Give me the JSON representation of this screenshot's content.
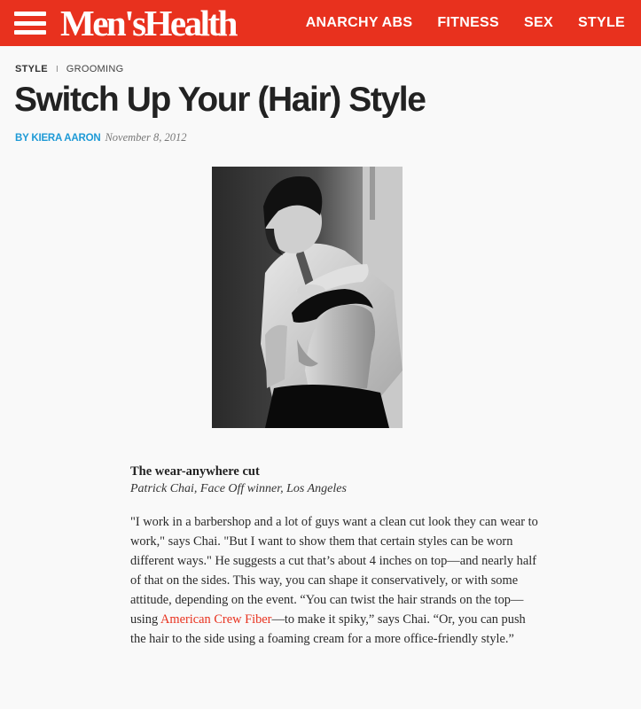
{
  "header": {
    "logo": "Men'sHealth",
    "nav": [
      "ANARCHY ABS",
      "FITNESS",
      "SEX",
      "STYLE"
    ]
  },
  "breadcrumb": {
    "primary": "STYLE",
    "separator": "I",
    "secondary": "GROOMING"
  },
  "article": {
    "title": "Switch Up Your (Hair) Style",
    "author": "BY KIERA AARON",
    "date": "November 8, 2012",
    "subhead": "The wear-anywhere cut",
    "credit": "Patrick Chai, Face Off winner, Los Angeles",
    "body_before_link": "\"I work in a barbershop and a lot of guys want a clean cut look they can wear to work,\" says Chai. \"But I want to show them that certain styles can be worn different ways.\" He suggests a cut that’s about 4 inches on top—and nearly half of that on the sides. This way, you can shape it conservatively, or with some attitude, depending on the event. “You can twist the hair strands on the top—using ",
    "link_text": "American Crew Fiber",
    "body_after_link": "—to make it spiky,” says Chai. “Or, you can push the hair to the side using a foaming cream for a more office-friendly style.”"
  },
  "colors": {
    "brand_red": "#e8311e",
    "author_blue": "#1e9ad6"
  }
}
